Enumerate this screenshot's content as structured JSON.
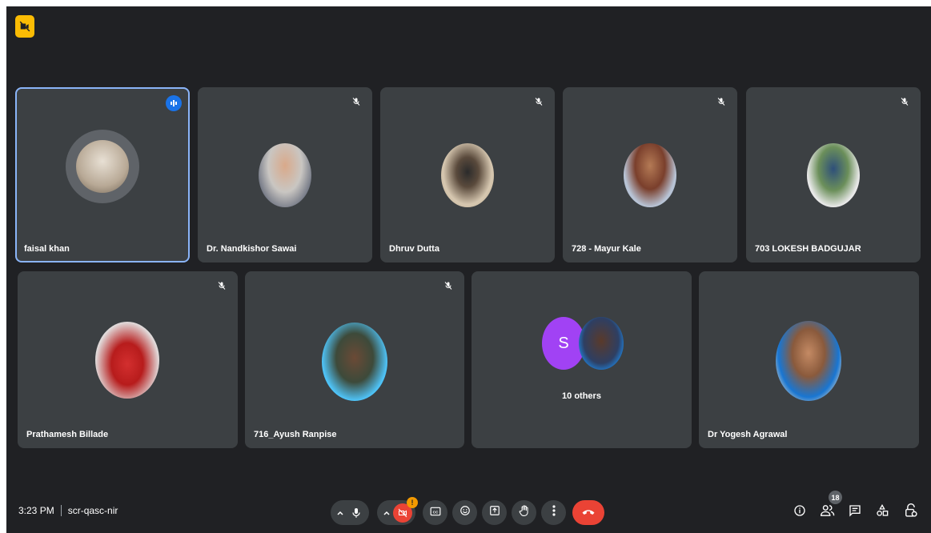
{
  "meeting": {
    "time": "3:23 PM",
    "separator": "|",
    "code": "scr-qasc-nir",
    "participant_count": "18",
    "camera_notice_count": "!"
  },
  "colors": {
    "background": "#202124",
    "tile": "#3c4043",
    "active_border": "#8ab4f8",
    "end_call": "#ea4335",
    "letter_avatar": "#a142f4",
    "warning_badge": "#fbbc04"
  },
  "tiles": [
    {
      "name": "faisal khan",
      "muted": false,
      "speaking": true
    },
    {
      "name": "Dr. Nandkishor Sawai",
      "muted": true
    },
    {
      "name": "Dhruv Dutta",
      "muted": true
    },
    {
      "name": "728 - Mayur Kale",
      "muted": true
    },
    {
      "name": "703 LOKESH BADGUJAR",
      "muted": true
    },
    {
      "name": "Prathamesh Billade",
      "muted": true
    },
    {
      "name": "716_Ayush Ranpise",
      "muted": true
    },
    {
      "name": "",
      "others_label": "10 others",
      "letter": "S"
    },
    {
      "name": "Dr Yogesh Agrawal",
      "muted": false
    }
  ],
  "controls": {
    "icons": [
      "caret-up-icon",
      "mic-icon",
      "camera-off-icon",
      "captions-icon",
      "emoji-icon",
      "present-icon",
      "raise-hand-icon",
      "more-options-icon",
      "end-call-icon"
    ],
    "right_icons": [
      "info-icon",
      "people-icon",
      "chat-icon",
      "activities-icon",
      "host-controls-icon"
    ]
  }
}
